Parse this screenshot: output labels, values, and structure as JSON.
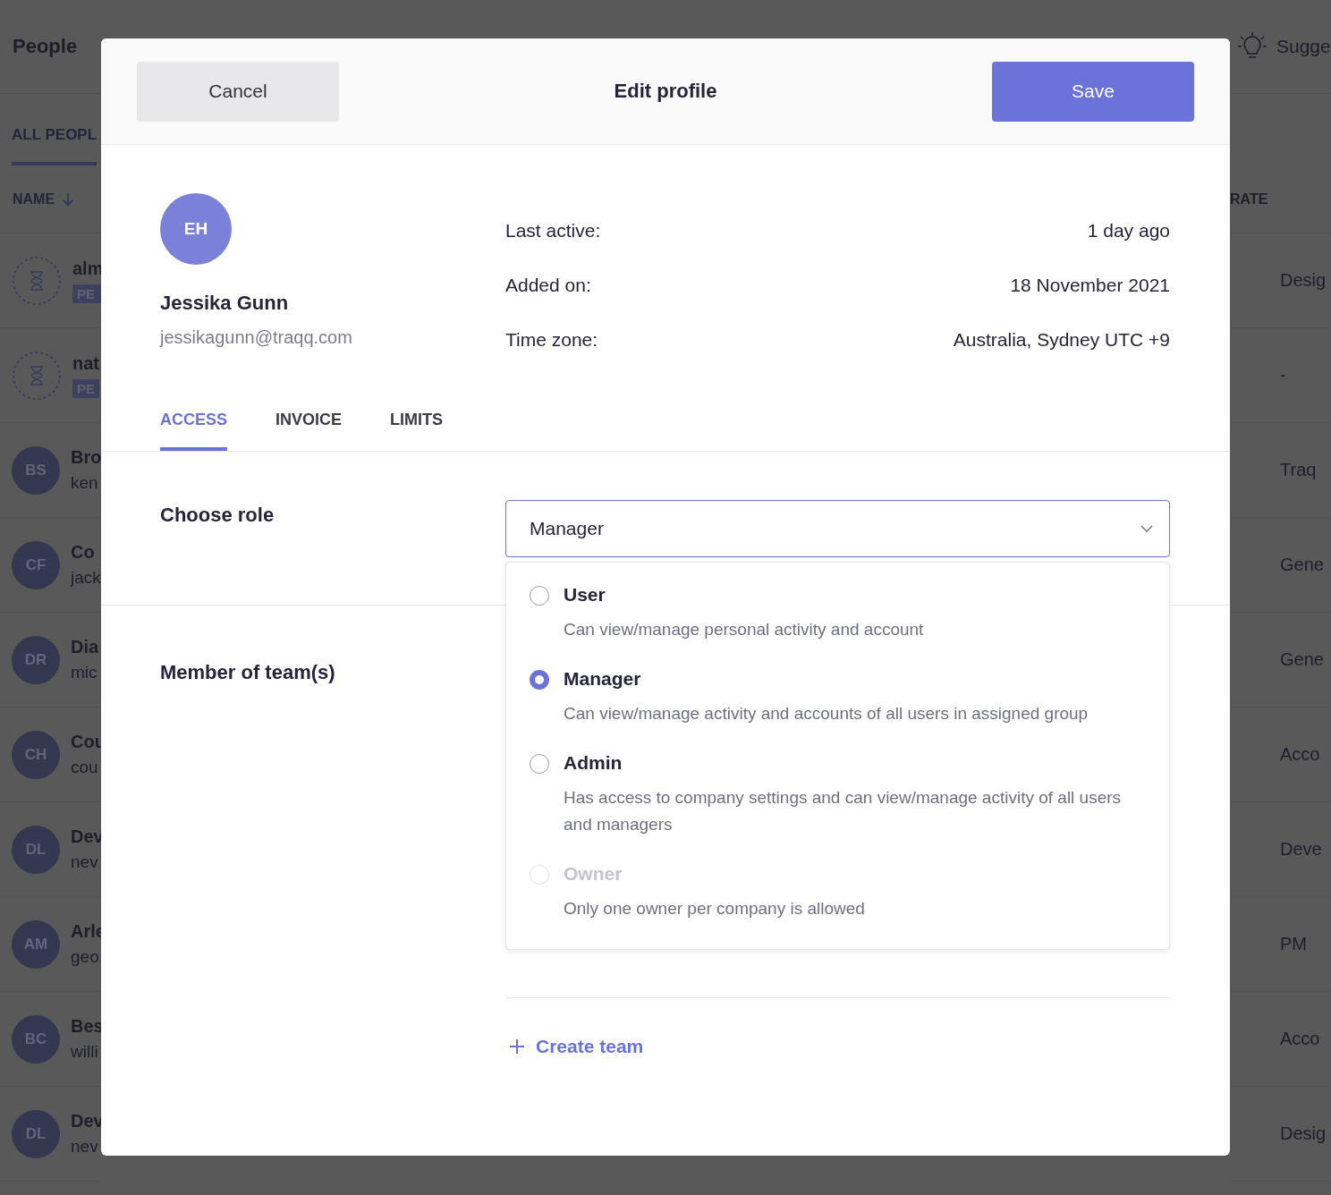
{
  "background": {
    "title": "People",
    "tab": "ALL PEOPL",
    "name_column": "NAME",
    "rate_column": "RATE",
    "suggest": "Sugge",
    "rows": [
      {
        "kind": "pending",
        "initials": "",
        "name": "alm",
        "sub": "PE"
      },
      {
        "kind": "pending",
        "initials": "",
        "name": "nat",
        "sub": "PE"
      },
      {
        "kind": "member",
        "initials": "BS",
        "name": "Bro",
        "sub": "ken"
      },
      {
        "kind": "member",
        "initials": "CF",
        "name": "Co",
        "sub": "jack"
      },
      {
        "kind": "member",
        "initials": "DR",
        "name": "Dia",
        "sub": "mic"
      },
      {
        "kind": "member",
        "initials": "CH",
        "name": "Cou",
        "sub": "cou"
      },
      {
        "kind": "member",
        "initials": "DL",
        "name": "Dev",
        "sub": "nev"
      },
      {
        "kind": "member",
        "initials": "AM",
        "name": "Arle",
        "sub": "geo"
      },
      {
        "kind": "member",
        "initials": "BC",
        "name": "Bes",
        "sub": "willi"
      },
      {
        "kind": "member",
        "initials": "DL",
        "name": "Dev",
        "sub": "nev"
      }
    ],
    "column_values": [
      "Desig",
      "-",
      "Traq",
      "Gene",
      "Gene",
      "Acco",
      "Deve",
      "PM",
      "Acco",
      "Desig"
    ]
  },
  "modal": {
    "cancel": "Cancel",
    "title": "Edit profile",
    "save": "Save",
    "profile": {
      "initials": "EH",
      "name": "Jessika Gunn",
      "email": "jessikagunn@traqq.com",
      "details": [
        {
          "label": "Last active:",
          "value": "1 day ago"
        },
        {
          "label": "Added on:",
          "value": "18 November 2021"
        },
        {
          "label": "Time zone:",
          "value": "Australia, Sydney UTC +9"
        }
      ]
    },
    "tabs": [
      {
        "label": "ACCESS",
        "selected": true
      },
      {
        "label": "INVOICE",
        "selected": false
      },
      {
        "label": "LIMITS",
        "selected": false
      }
    ],
    "role": {
      "label": "Choose role",
      "value": "Manager",
      "expanded": true,
      "options": [
        {
          "title": "User",
          "description": "Can view/manage personal activity and account",
          "selected": false,
          "disabled": false
        },
        {
          "title": "Manager",
          "description": "Can view/manage activity and accounts of all users in assigned group",
          "selected": true,
          "disabled": false
        },
        {
          "title": "Admin",
          "description": "Has access to company settings and can view/manage activity of all users and managers",
          "selected": false,
          "disabled": false
        },
        {
          "title": "Owner",
          "description": "Only one owner per company is allowed",
          "selected": false,
          "disabled": true
        }
      ]
    },
    "teams": {
      "label": "Member of team(s)",
      "create": "Create team"
    }
  }
}
